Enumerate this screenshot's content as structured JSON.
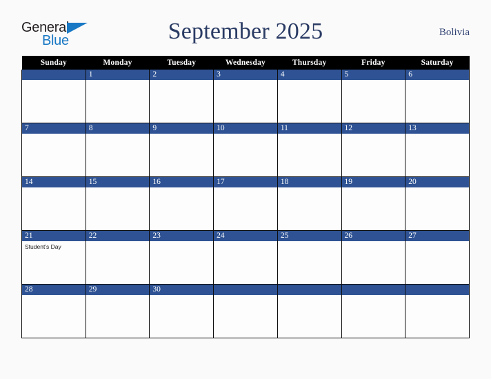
{
  "brand": {
    "word_one": "General",
    "word_two": "Blue",
    "accent_color": "#1878c4",
    "text_color": "#231f20",
    "triangle_icon": "brand-triangle-icon"
  },
  "header": {
    "title": "September 2025",
    "region": "Bolivia",
    "title_color": "#2a3b64",
    "region_color": "#2f4272"
  },
  "calendar": {
    "header_background": "#000000",
    "header_text_color": "#ffffff",
    "daynum_background": "#2e5293",
    "daynum_text_color": "#ffffff",
    "cell_background": "#fdfdfd",
    "grid_line_color": "#0d0d0d",
    "weekday_headers": [
      "Sunday",
      "Monday",
      "Tuesday",
      "Wednesday",
      "Thursday",
      "Friday",
      "Saturday"
    ],
    "weeks": [
      [
        {
          "date": "",
          "event": ""
        },
        {
          "date": "1",
          "event": ""
        },
        {
          "date": "2",
          "event": ""
        },
        {
          "date": "3",
          "event": ""
        },
        {
          "date": "4",
          "event": ""
        },
        {
          "date": "5",
          "event": ""
        },
        {
          "date": "6",
          "event": ""
        }
      ],
      [
        {
          "date": "7",
          "event": ""
        },
        {
          "date": "8",
          "event": ""
        },
        {
          "date": "9",
          "event": ""
        },
        {
          "date": "10",
          "event": ""
        },
        {
          "date": "11",
          "event": ""
        },
        {
          "date": "12",
          "event": ""
        },
        {
          "date": "13",
          "event": ""
        }
      ],
      [
        {
          "date": "14",
          "event": ""
        },
        {
          "date": "15",
          "event": ""
        },
        {
          "date": "16",
          "event": ""
        },
        {
          "date": "17",
          "event": ""
        },
        {
          "date": "18",
          "event": ""
        },
        {
          "date": "19",
          "event": ""
        },
        {
          "date": "20",
          "event": ""
        }
      ],
      [
        {
          "date": "21",
          "event": "Student’s Day"
        },
        {
          "date": "22",
          "event": ""
        },
        {
          "date": "23",
          "event": ""
        },
        {
          "date": "24",
          "event": ""
        },
        {
          "date": "25",
          "event": ""
        },
        {
          "date": "26",
          "event": ""
        },
        {
          "date": "27",
          "event": ""
        }
      ],
      [
        {
          "date": "28",
          "event": ""
        },
        {
          "date": "29",
          "event": ""
        },
        {
          "date": "30",
          "event": ""
        },
        {
          "date": "",
          "event": ""
        },
        {
          "date": "",
          "event": ""
        },
        {
          "date": "",
          "event": ""
        },
        {
          "date": "",
          "event": ""
        }
      ]
    ]
  }
}
